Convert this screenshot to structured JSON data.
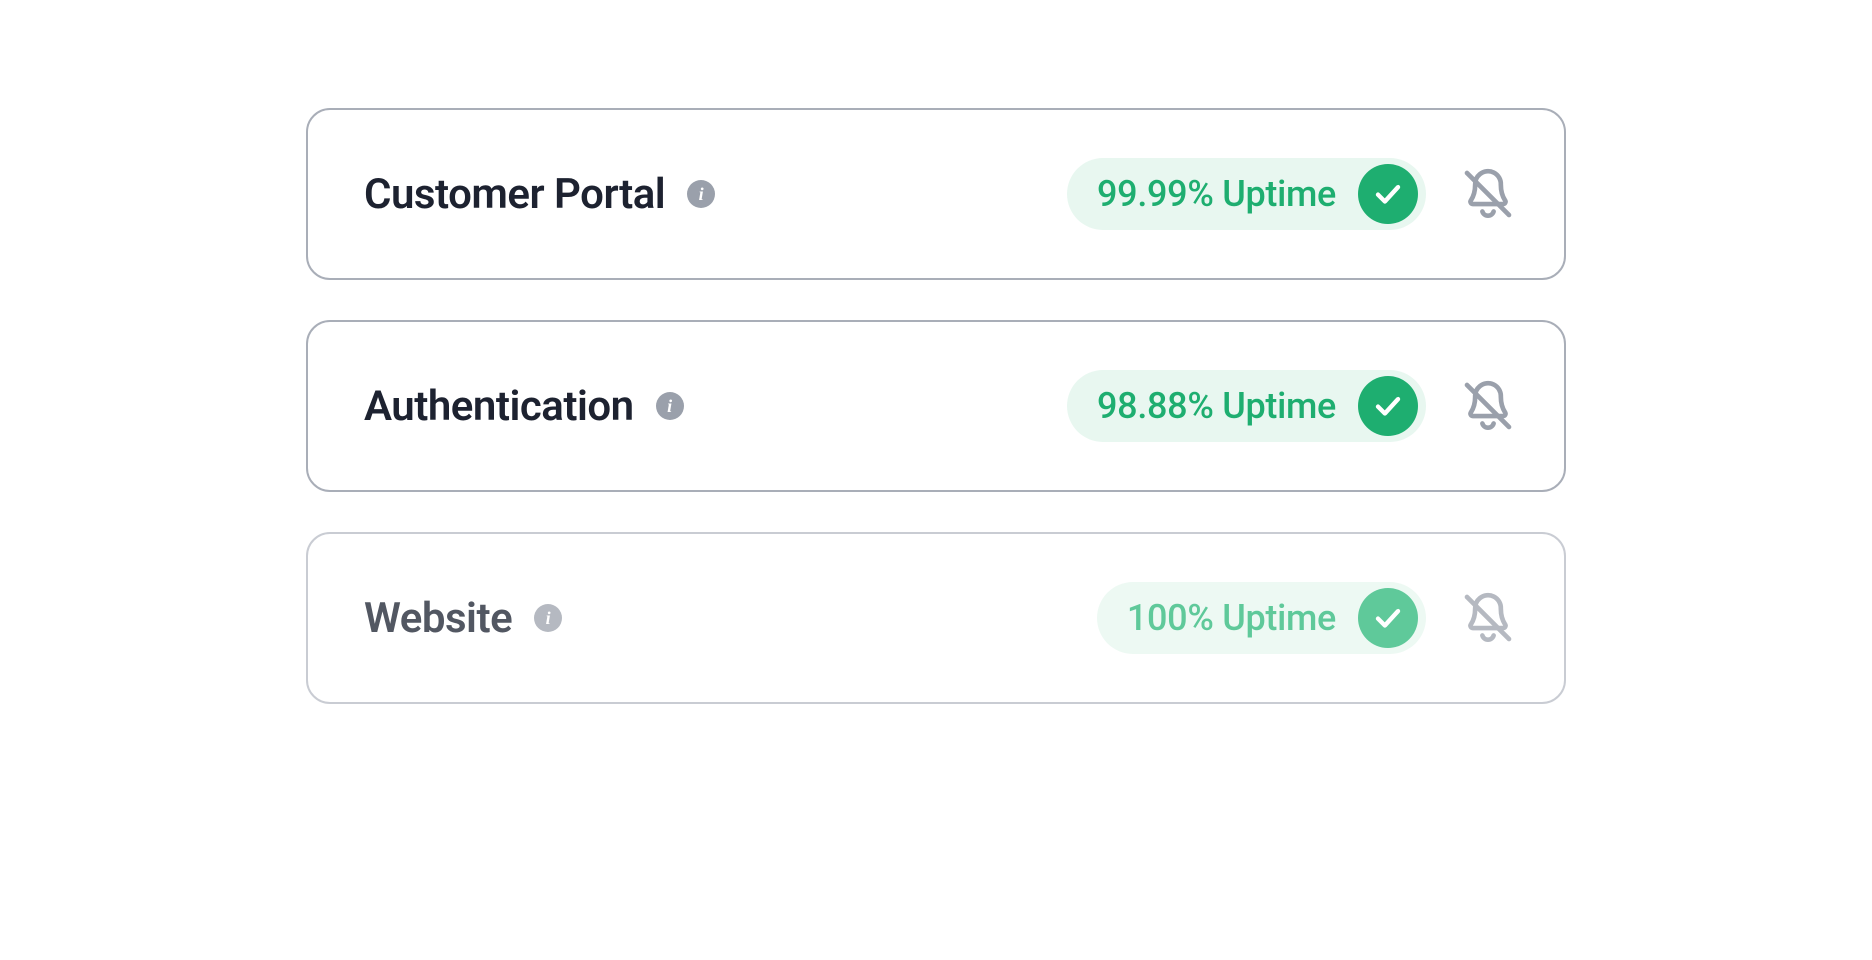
{
  "services": [
    {
      "name": "Customer Portal",
      "uptime": "99.99% Uptime",
      "faded": false
    },
    {
      "name": "Authentication",
      "uptime": "98.88% Uptime",
      "faded": false
    },
    {
      "name": "Website",
      "uptime": "100% Uptime",
      "faded": true
    }
  ],
  "colors": {
    "accent_green": "#1eae70",
    "pill_bg": "#e8f7f0",
    "border": "#a9aeb8",
    "icon_gray": "#9aa0ab"
  }
}
